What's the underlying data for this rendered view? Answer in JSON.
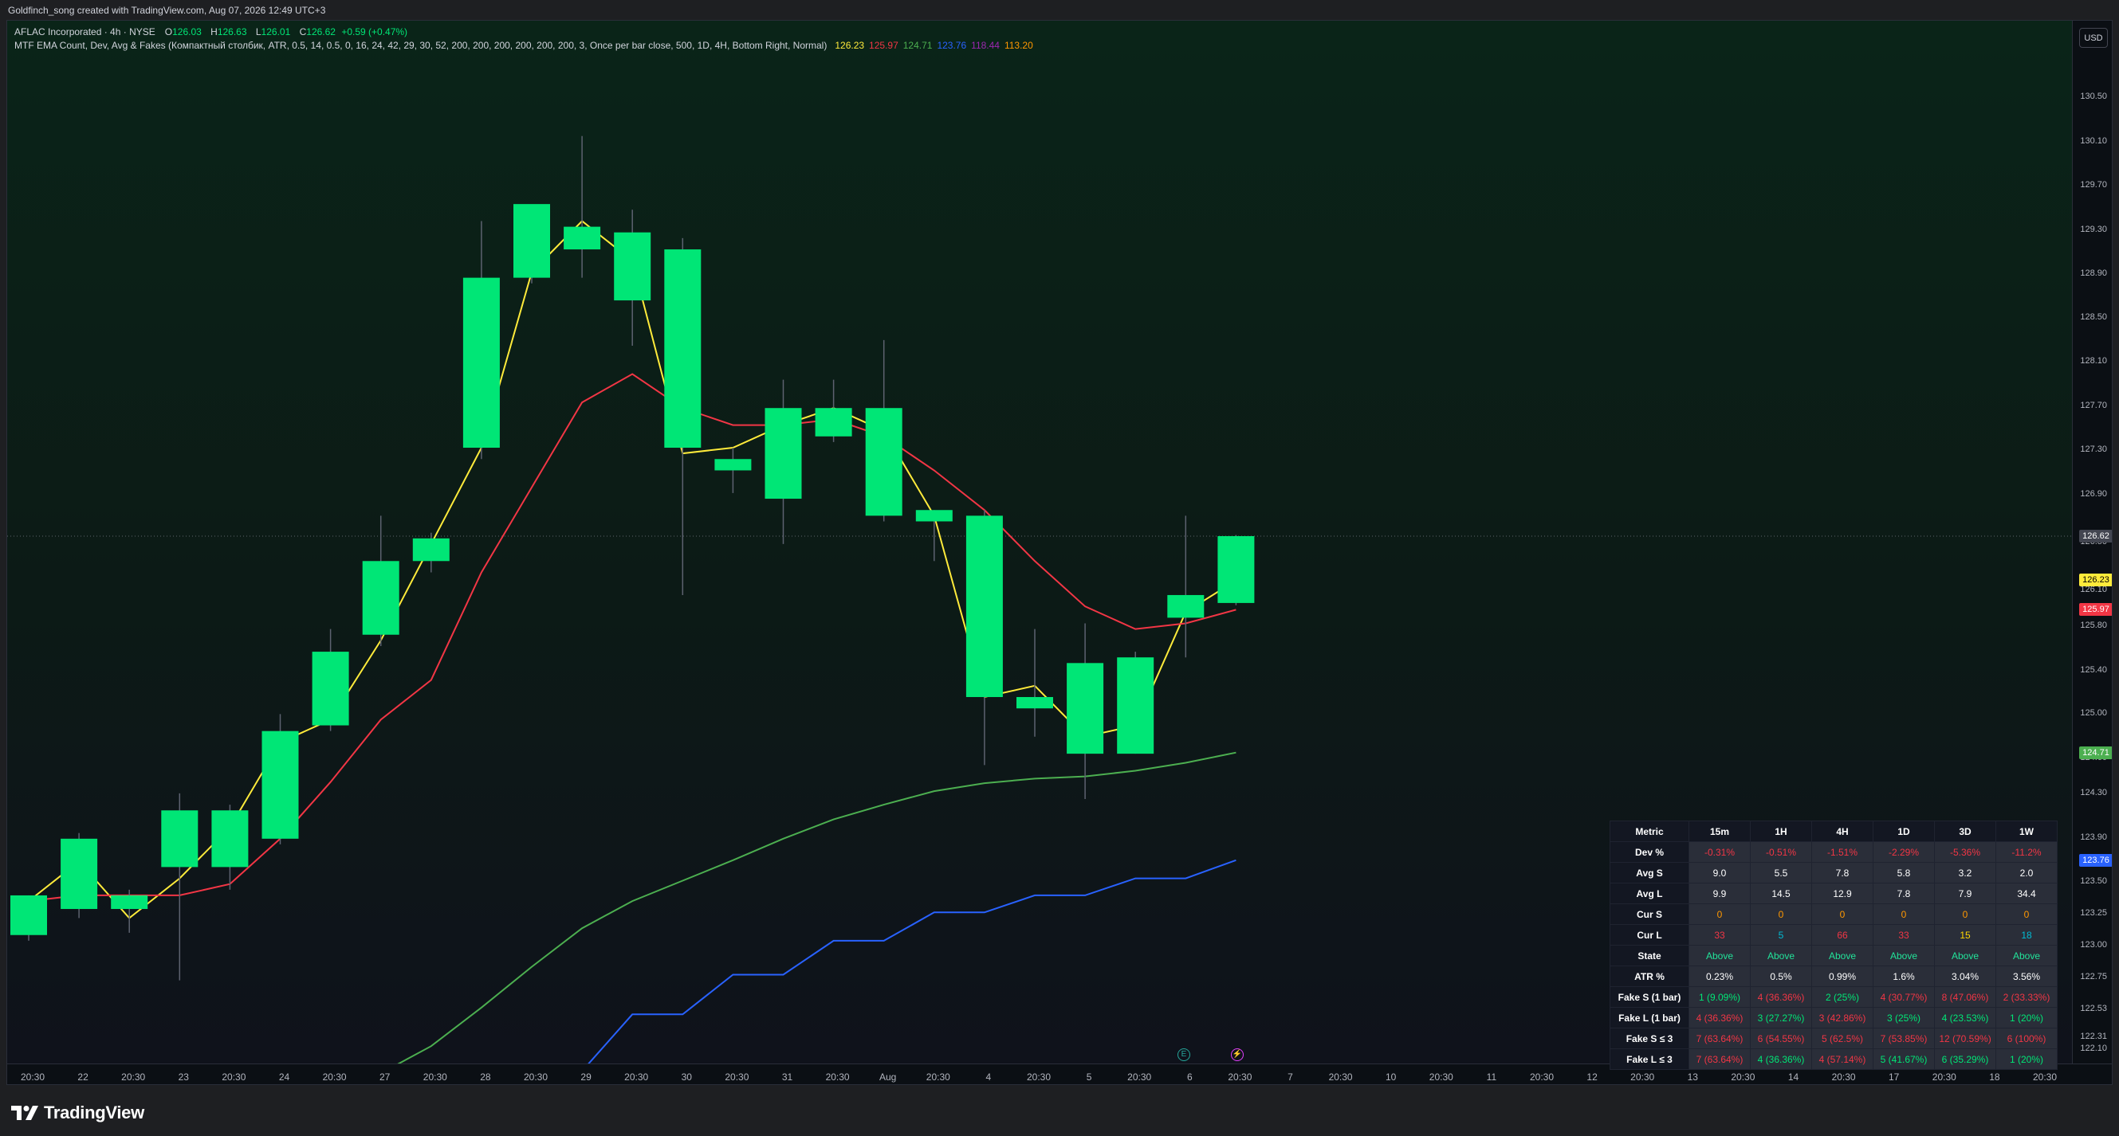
{
  "header": {
    "title": "Goldfinch_song created with TradingView.com, Aug 07, 2026 12:49 UTC+3"
  },
  "legend": {
    "symbol": "AFLAC Incorporated · 4h · NYSE",
    "ohlc": {
      "o_label": "O",
      "o": "126.03",
      "h_label": "H",
      "h": "126.63",
      "l_label": "L",
      "l": "126.01",
      "c_label": "C",
      "c": "126.62",
      "change": "+0.59 (+0.47%)"
    },
    "indicator": "MTF EMA Count, Dev, Avg & Fakes (Компактный столбик, ATR, 0.5, 14, 0.5, 0, 16, 24, 42, 29, 30, 52, 200, 200, 200, 200, 200, 200, 3, Once per bar close, 500, 1D, 4H, Bottom Right, Normal)",
    "indicator_values": [
      {
        "value": "126.23",
        "color": "#ffeb3b"
      },
      {
        "value": "125.97",
        "color": "#f23645"
      },
      {
        "value": "124.71",
        "color": "#4caf50"
      },
      {
        "value": "123.76",
        "color": "#2962ff"
      },
      {
        "value": "118.44",
        "color": "#9c27b0"
      },
      {
        "value": "113.20",
        "color": "#ff9800"
      }
    ]
  },
  "price_axis": {
    "currency_button": "USD",
    "ticks": [
      "130.50",
      "130.10",
      "129.70",
      "129.30",
      "128.90",
      "128.50",
      "128.10",
      "127.70",
      "127.30",
      "126.90",
      "126.50",
      "126.10",
      "125.80",
      "125.40",
      "125.00",
      "124.60",
      "124.30",
      "123.90",
      "123.50",
      "123.25",
      "123.00",
      "122.75",
      "122.53",
      "122.31",
      "122.10"
    ],
    "tags": [
      {
        "value": "126.62",
        "bg": "#434651",
        "fg": "#ffffff"
      },
      {
        "value": "126.23",
        "bg": "#ffeb3b",
        "fg": "#000000"
      },
      {
        "value": "125.97",
        "bg": "#f23645",
        "fg": "#ffffff"
      },
      {
        "value": "124.71",
        "bg": "#4caf50",
        "fg": "#ffffff"
      },
      {
        "value": "123.76",
        "bg": "#2962ff",
        "fg": "#ffffff"
      }
    ]
  },
  "time_axis": {
    "ticks": [
      "20:30",
      "22",
      "20:30",
      "23",
      "20:30",
      "24",
      "20:30",
      "27",
      "20:30",
      "28",
      "20:30",
      "29",
      "20:30",
      "30",
      "20:30",
      "31",
      "20:30",
      "Aug",
      "20:30",
      "4",
      "20:30",
      "5",
      "20:30",
      "6",
      "20:30",
      "7",
      "20:30",
      "10",
      "20:30",
      "11",
      "20:30",
      "12",
      "20:30",
      "13",
      "20:30",
      "14",
      "20:30",
      "17",
      "20:30",
      "18",
      "20:30"
    ]
  },
  "chart_data": {
    "type": "candlestick",
    "x": [
      "Jul 21 20:30",
      "Jul 22",
      "Jul 22 20:30",
      "Jul 23",
      "Jul 23 20:30",
      "Jul 24",
      "Jul 24 20:30",
      "Jul 27",
      "Jul 27 20:30",
      "Jul 28",
      "Jul 28 20:30",
      "Jul 29",
      "Jul 29 20:30",
      "Jul 30",
      "Jul 30 20:30",
      "Jul 31",
      "Jul 31 20:30",
      "Aug 3",
      "Aug 3 20:30",
      "Aug 4",
      "Aug 4 20:30",
      "Aug 5",
      "Aug 5 20:30",
      "Aug 6",
      "Aug 6 20:30"
    ],
    "candles": [
      {
        "o": 123.1,
        "h": 123.45,
        "l": 123.05,
        "c": 123.45
      },
      {
        "o": 123.33,
        "h": 124.0,
        "l": 123.25,
        "c": 123.95
      },
      {
        "o": 123.33,
        "h": 123.5,
        "l": 123.12,
        "c": 123.45
      },
      {
        "o": 123.7,
        "h": 124.35,
        "l": 122.7,
        "c": 124.2
      },
      {
        "o": 123.7,
        "h": 124.25,
        "l": 123.5,
        "c": 124.2
      },
      {
        "o": 123.95,
        "h": 125.05,
        "l": 123.9,
        "c": 124.9
      },
      {
        "o": 124.95,
        "h": 125.8,
        "l": 124.9,
        "c": 125.6
      },
      {
        "o": 125.75,
        "h": 126.8,
        "l": 125.65,
        "c": 126.4
      },
      {
        "o": 126.4,
        "h": 126.65,
        "l": 126.3,
        "c": 126.6
      },
      {
        "o": 127.4,
        "h": 129.4,
        "l": 127.3,
        "c": 128.9
      },
      {
        "o": 128.9,
        "h": 129.4,
        "l": 128.85,
        "c": 129.55
      },
      {
        "o": 129.15,
        "h": 130.15,
        "l": 128.9,
        "c": 129.35
      },
      {
        "o": 128.7,
        "h": 129.5,
        "l": 128.3,
        "c": 129.3
      },
      {
        "o": 127.4,
        "h": 129.25,
        "l": 126.1,
        "c": 129.15
      },
      {
        "o": 127.2,
        "h": 127.4,
        "l": 127.0,
        "c": 127.3
      },
      {
        "o": 126.95,
        "h": 128.0,
        "l": 126.55,
        "c": 127.75
      },
      {
        "o": 127.5,
        "h": 128.0,
        "l": 127.45,
        "c": 127.75
      },
      {
        "o": 126.8,
        "h": 128.35,
        "l": 126.75,
        "c": 127.75
      },
      {
        "o": 126.75,
        "h": 126.85,
        "l": 126.4,
        "c": 126.85
      },
      {
        "o": 125.2,
        "h": 126.85,
        "l": 124.6,
        "c": 126.8
      },
      {
        "o": 125.1,
        "h": 125.8,
        "l": 124.85,
        "c": 125.2
      },
      {
        "o": 124.7,
        "h": 125.85,
        "l": 124.3,
        "c": 125.5
      },
      {
        "o": 124.7,
        "h": 125.6,
        "l": 124.7,
        "c": 125.55
      },
      {
        "o": 125.9,
        "h": 126.8,
        "l": 125.55,
        "c": 126.1
      },
      {
        "o": 126.03,
        "h": 126.63,
        "l": 126.01,
        "c": 126.62
      }
    ],
    "series": [
      {
        "values": [
          123.4,
          123.75,
          123.25,
          123.6,
          124.05,
          124.8,
          125.0,
          125.7,
          126.55,
          127.4,
          128.95,
          129.4,
          129.05,
          127.35,
          127.4,
          127.6,
          127.75,
          127.55,
          126.8,
          125.2,
          125.3,
          124.85,
          124.95,
          125.95,
          126.23
        ],
        "color": "#ffeb3b"
      },
      {
        "values": [
          123.4,
          123.45,
          123.45,
          123.45,
          123.55,
          123.95,
          124.45,
          125.0,
          125.35,
          126.3,
          127.05,
          127.8,
          128.05,
          127.75,
          127.6,
          127.6,
          127.65,
          127.5,
          127.2,
          126.85,
          126.4,
          126.0,
          125.8,
          125.85,
          125.97
        ],
        "color": "#f23645"
      },
      {
        "values": [
          null,
          null,
          null,
          null,
          null,
          null,
          null,
          121.88,
          122.12,
          122.46,
          122.82,
          123.16,
          123.4,
          123.58,
          123.76,
          123.95,
          124.12,
          124.25,
          124.37,
          124.44,
          124.48,
          124.5,
          124.55,
          124.62,
          124.71
        ],
        "color": "#4caf50"
      },
      {
        "values": [
          null,
          null,
          null,
          null,
          null,
          null,
          null,
          null,
          null,
          null,
          121.9,
          121.9,
          122.4,
          122.4,
          122.75,
          122.75,
          123.05,
          123.05,
          123.3,
          123.3,
          123.45,
          123.45,
          123.6,
          123.6,
          123.76
        ],
        "color": "#2962ff"
      }
    ],
    "last_price": 126.62
  },
  "stats_table": {
    "headers": [
      "Metric",
      "15m",
      "1H",
      "4H",
      "1D",
      "3D",
      "1W"
    ],
    "rows": [
      {
        "label": "Dev %",
        "cells": [
          {
            "v": "-0.31%",
            "c": "red"
          },
          {
            "v": "-0.51%",
            "c": "red"
          },
          {
            "v": "-1.51%",
            "c": "red"
          },
          {
            "v": "-2.29%",
            "c": "red"
          },
          {
            "v": "-5.36%",
            "c": "red"
          },
          {
            "v": "-11.2%",
            "c": "red"
          }
        ]
      },
      {
        "label": "Avg S",
        "cells": [
          {
            "v": "9.0",
            "c": "white"
          },
          {
            "v": "5.5",
            "c": "white"
          },
          {
            "v": "7.8",
            "c": "white"
          },
          {
            "v": "5.8",
            "c": "white"
          },
          {
            "v": "3.2",
            "c": "white"
          },
          {
            "v": "2.0",
            "c": "white"
          }
        ]
      },
      {
        "label": "Avg L",
        "cells": [
          {
            "v": "9.9",
            "c": "white"
          },
          {
            "v": "14.5",
            "c": "white"
          },
          {
            "v": "12.9",
            "c": "white"
          },
          {
            "v": "7.8",
            "c": "white"
          },
          {
            "v": "7.9",
            "c": "white"
          },
          {
            "v": "34.4",
            "c": "white"
          }
        ]
      },
      {
        "label": "Cur S",
        "cells": [
          {
            "v": "0",
            "c": "orange"
          },
          {
            "v": "0",
            "c": "orange"
          },
          {
            "v": "0",
            "c": "orange"
          },
          {
            "v": "0",
            "c": "orange"
          },
          {
            "v": "0",
            "c": "orange"
          },
          {
            "v": "0",
            "c": "orange"
          }
        ]
      },
      {
        "label": "Cur L",
        "cells": [
          {
            "v": "33",
            "c": "red"
          },
          {
            "v": "5",
            "c": "blue"
          },
          {
            "v": "66",
            "c": "red"
          },
          {
            "v": "33",
            "c": "red"
          },
          {
            "v": "15",
            "c": "yellow"
          },
          {
            "v": "18",
            "c": "blue"
          }
        ]
      },
      {
        "label": "State",
        "cells": [
          {
            "v": "Above",
            "c": "green2"
          },
          {
            "v": "Above",
            "c": "green2"
          },
          {
            "v": "Above",
            "c": "green2"
          },
          {
            "v": "Above",
            "c": "green2"
          },
          {
            "v": "Above",
            "c": "green2"
          },
          {
            "v": "Above",
            "c": "green2"
          }
        ]
      },
      {
        "label": "ATR %",
        "cells": [
          {
            "v": "0.23%",
            "c": "white"
          },
          {
            "v": "0.5%",
            "c": "white"
          },
          {
            "v": "0.99%",
            "c": "white"
          },
          {
            "v": "1.6%",
            "c": "white"
          },
          {
            "v": "3.04%",
            "c": "white"
          },
          {
            "v": "3.56%",
            "c": "white"
          }
        ]
      },
      {
        "label": "Fake S (1 bar)",
        "cells": [
          {
            "v": "1 (9.09%)",
            "c": "green"
          },
          {
            "v": "4 (36.36%)",
            "c": "red"
          },
          {
            "v": "2 (25%)",
            "c": "green"
          },
          {
            "v": "4 (30.77%)",
            "c": "red"
          },
          {
            "v": "8 (47.06%)",
            "c": "red"
          },
          {
            "v": "2 (33.33%)",
            "c": "red"
          }
        ]
      },
      {
        "label": "Fake L (1 bar)",
        "cells": [
          {
            "v": "4 (36.36%)",
            "c": "red"
          },
          {
            "v": "3 (27.27%)",
            "c": "green"
          },
          {
            "v": "3 (42.86%)",
            "c": "red"
          },
          {
            "v": "3 (25%)",
            "c": "green"
          },
          {
            "v": "4 (23.53%)",
            "c": "green"
          },
          {
            "v": "1 (20%)",
            "c": "green"
          }
        ]
      },
      {
        "label": "Fake S ≤ 3",
        "cells": [
          {
            "v": "7 (63.64%)",
            "c": "red"
          },
          {
            "v": "6 (54.55%)",
            "c": "red"
          },
          {
            "v": "5 (62.5%)",
            "c": "red"
          },
          {
            "v": "7 (53.85%)",
            "c": "red"
          },
          {
            "v": "12 (70.59%)",
            "c": "red"
          },
          {
            "v": "6 (100%)",
            "c": "red"
          }
        ]
      },
      {
        "label": "Fake L ≤ 3",
        "cells": [
          {
            "v": "7 (63.64%)",
            "c": "red"
          },
          {
            "v": "4 (36.36%)",
            "c": "green"
          },
          {
            "v": "4 (57.14%)",
            "c": "red"
          },
          {
            "v": "5 (41.67%)",
            "c": "green"
          },
          {
            "v": "6 (35.29%)",
            "c": "green"
          },
          {
            "v": "1 (20%)",
            "c": "green"
          }
        ]
      }
    ]
  },
  "chips": [
    {
      "name": "earnings-icon",
      "glyph": "E"
    },
    {
      "name": "dividends-icon",
      "glyph": "⚡"
    }
  ],
  "footer": {
    "brand": "TradingView"
  },
  "colors": {
    "up_candle": "#00e676",
    "wick": "#5d6270",
    "grid_price_line": "#9598a1"
  }
}
